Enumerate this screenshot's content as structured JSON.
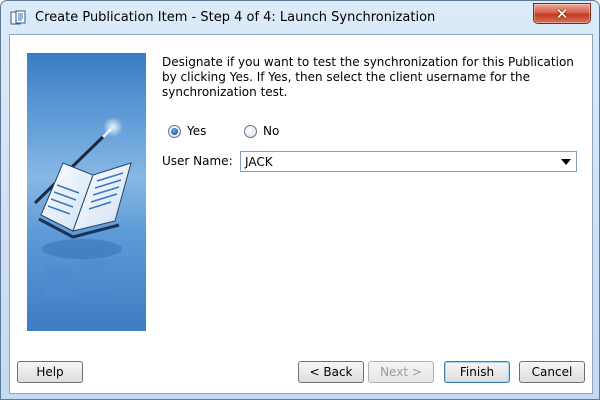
{
  "window": {
    "title": "Create Publication Item - Step 4 of 4: Launch Synchronization",
    "close_glyph": "✕"
  },
  "content": {
    "prompt": "Designate if you want to test the synchronization for this Publication by clicking Yes. If Yes, then select the client username for the synchronization test.",
    "radio_options": [
      {
        "label": "Yes",
        "selected": true
      },
      {
        "label": "No",
        "selected": false
      }
    ],
    "username_label": "User Name:",
    "username_value": "JACK"
  },
  "buttons": {
    "help": "Help",
    "back": "< Back",
    "next": "Next >",
    "finish": "Finish",
    "cancel": "Cancel"
  },
  "icons": {
    "title": "publication-wizard-icon",
    "close": "close-icon",
    "dropdown": "chevron-down-icon",
    "banner": "book-wand-illustration"
  },
  "colors": {
    "window_frame": "#c4daf0",
    "close_button": "#c23b22",
    "banner_blue": "#5d9ad6",
    "radio_selected": "#1f5fb5"
  }
}
